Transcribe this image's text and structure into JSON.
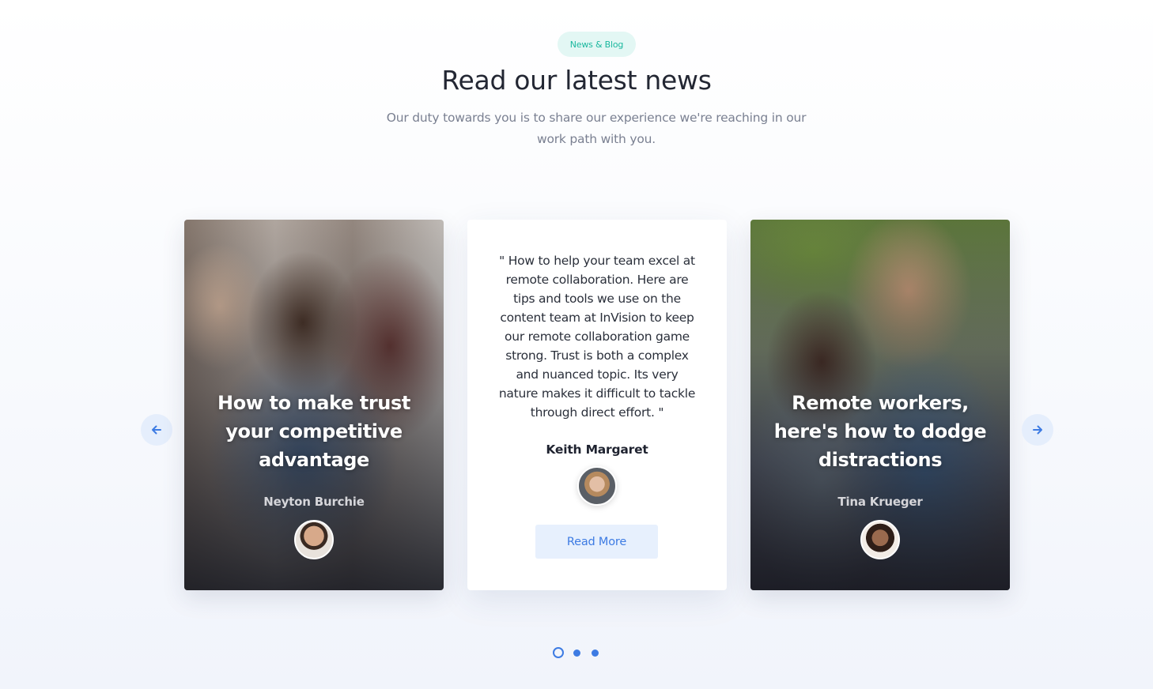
{
  "section": {
    "badge": "News & Blog",
    "title": "Read our latest news",
    "subtitle": "Our duty towards you is to share our experience we're reaching in our work path with you."
  },
  "cards": [
    {
      "headline": "How to make trust your competitive advantage",
      "author": "Neyton Burchie"
    },
    {
      "quote": "\" How to help your team excel at remote collaboration. Here are tips and tools we use on the content team at InVision to keep our remote collaboration game strong. Trust is both a complex and nuanced topic. Its very nature makes it difficult to tackle through direct effort. \"",
      "author": "Keith Margaret",
      "button_label": "Read More"
    },
    {
      "headline": "Remote workers, here's how to dodge distractions",
      "author": "Tina Krueger"
    }
  ],
  "nav": {
    "prev_icon": "arrow-left-icon",
    "next_icon": "arrow-right-icon"
  },
  "pagination": {
    "count": 3,
    "active_index": 0
  },
  "colors": {
    "accent": "#3d7be3",
    "badge_text": "#1cb89f",
    "badge_bg": "#e3f7f4",
    "button_bg": "#e7f0fd"
  }
}
